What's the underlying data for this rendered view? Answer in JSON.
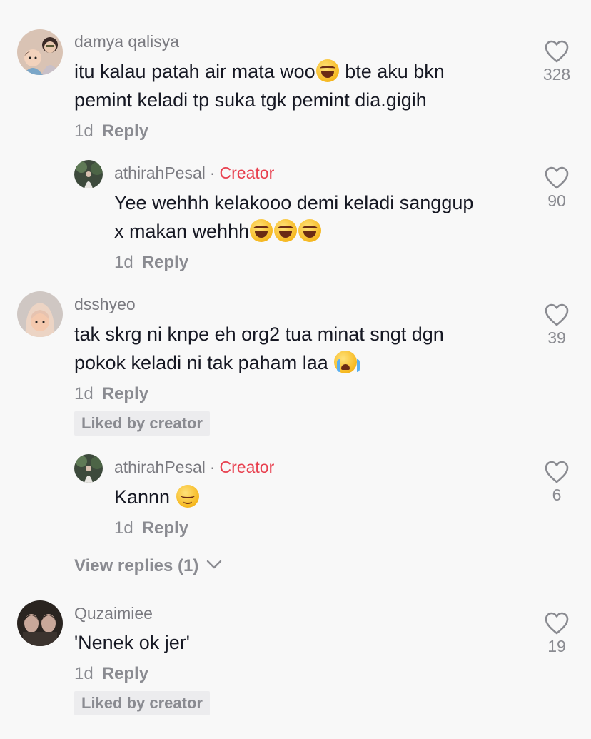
{
  "colors": {
    "background": "#f8f8f8",
    "creator_accent": "#e8404f",
    "secondary_text": "#8a8b91"
  },
  "comments": [
    {
      "username": "damya qalisya",
      "text_line1": "itu kalau patah air mata woo",
      "emoji1": "face-with-tears-of-joy",
      "text_line1b": " bte aku bkn",
      "text_line2": "pemint keladi tp suka tgk pemint dia.gigih",
      "time": "1d",
      "reply_label": "Reply",
      "likes": "328"
    },
    {
      "username": "athirahPesal",
      "dot": "·",
      "badge": "Creator",
      "text_line1": "Yee wehhh kelakooo demi keladi sanggup",
      "text_line2": "x makan wehhh",
      "time": "1d",
      "reply_label": "Reply",
      "likes": "90"
    },
    {
      "username": "dsshyeo",
      "text_line1": "tak skrg ni knpe eh org2 tua minat sngt dgn",
      "text_line2": "pokok keladi ni tak paham laa ",
      "time": "1d",
      "reply_label": "Reply",
      "likes": "39",
      "liked_by": "Liked by creator"
    },
    {
      "username": "athirahPesal",
      "dot": "·",
      "badge": "Creator",
      "text_line1": "Kannn ",
      "time": "1d",
      "reply_label": "Reply",
      "likes": "6"
    },
    {
      "username": "Quzaimiee",
      "text_line1": "'Nenek ok jer'",
      "time": "1d",
      "reply_label": "Reply",
      "likes": "19",
      "liked_by": "Liked by creator"
    }
  ],
  "view_replies": "View replies (1)",
  "icons": [
    "heart-icon",
    "chevron-down-icon"
  ]
}
